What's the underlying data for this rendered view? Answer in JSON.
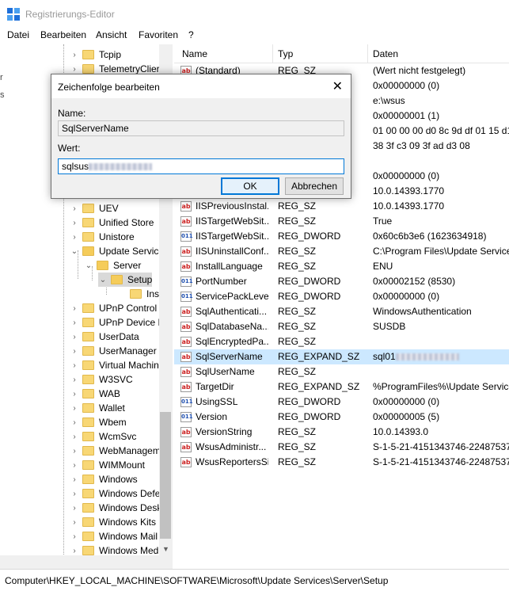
{
  "window": {
    "title": "Registrierungs-Editor"
  },
  "menu": [
    "Datei",
    "Bearbeiten",
    "Ansicht",
    "Favoriten",
    "?"
  ],
  "left_edge_chars": [
    "r",
    "s"
  ],
  "tree": {
    "items": [
      {
        "label": "Tcpip",
        "expander": "›",
        "open": false
      },
      {
        "label": "TelemetryClier",
        "expander": "›",
        "open": false
      },
      {
        "label": "UEV",
        "expander": "›",
        "open": false
      },
      {
        "label": "Unified Store",
        "expander": "›",
        "open": false
      },
      {
        "label": "Unistore",
        "expander": "›",
        "open": false
      },
      {
        "label": "Update Service",
        "expander": "⌄",
        "open": true
      },
      {
        "label": "Server",
        "expander": "⌄",
        "open": true
      },
      {
        "label": "Setup",
        "expander": "⌄",
        "open": true
      },
      {
        "label": "Inst",
        "expander": "",
        "open": false
      },
      {
        "label": "UPnP Control",
        "expander": "›",
        "open": false
      },
      {
        "label": "UPnP Device H",
        "expander": "›",
        "open": false
      },
      {
        "label": "UserData",
        "expander": "›",
        "open": false
      },
      {
        "label": "UserManager",
        "expander": "›",
        "open": false
      },
      {
        "label": "Virtual Machin",
        "expander": "›",
        "open": false
      },
      {
        "label": "W3SVC",
        "expander": "›",
        "open": false
      },
      {
        "label": "WAB",
        "expander": "›",
        "open": false
      },
      {
        "label": "Wallet",
        "expander": "›",
        "open": false
      },
      {
        "label": "Wbem",
        "expander": "›",
        "open": false
      },
      {
        "label": "WcmSvc",
        "expander": "›",
        "open": false
      },
      {
        "label": "WebManagem",
        "expander": "›",
        "open": false
      },
      {
        "label": "WIMMount",
        "expander": "›",
        "open": false
      },
      {
        "label": "Windows",
        "expander": "›",
        "open": false
      },
      {
        "label": "Windows Defe",
        "expander": "›",
        "open": false
      },
      {
        "label": "Windows Desk",
        "expander": "›",
        "open": false
      },
      {
        "label": "Windows Kits",
        "expander": "›",
        "open": false
      },
      {
        "label": "Windows Mail",
        "expander": "›",
        "open": false
      },
      {
        "label": "Windows Med",
        "expander": "›",
        "open": false
      }
    ]
  },
  "columns": {
    "name": "Name",
    "type": "Typ",
    "data": "Daten"
  },
  "values": [
    {
      "name": "(Standard)",
      "type": "REG_SZ",
      "data": "(Wert nicht festgelegt)",
      "icon": "ab",
      "selected": false,
      "redacted": false
    },
    {
      "name": "",
      "type": "",
      "data": "0x00000000 (0)",
      "icon": "",
      "selected": false,
      "redacted": false
    },
    {
      "name": "",
      "type": "",
      "data": "e:\\wsus",
      "icon": "",
      "selected": false,
      "redacted": false
    },
    {
      "name": "",
      "type": "",
      "data": "0x00000001 (1)",
      "icon": "",
      "selected": false,
      "redacted": false
    },
    {
      "name": "",
      "type": "",
      "data": "01 00 00 00 d0 8c 9d df 01 15 d1 1",
      "icon": "",
      "selected": false,
      "redacted": false
    },
    {
      "name": "",
      "type": "",
      "data": "38 3f c3 09 3f ad d3 08",
      "icon": "",
      "selected": false,
      "redacted": false
    },
    {
      "name": "",
      "type": "",
      "data": "",
      "icon": "",
      "selected": false,
      "redacted": false
    },
    {
      "name": "",
      "type": "",
      "data": "0x00000000 (0)",
      "icon": "",
      "selected": false,
      "redacted": false
    },
    {
      "name": "",
      "type": "",
      "data": "10.0.14393.1770",
      "icon": "",
      "selected": false,
      "redacted": false
    },
    {
      "name": "IISPreviousInstal...",
      "type": "REG_SZ",
      "data": "10.0.14393.1770",
      "icon": "ab",
      "selected": false,
      "redacted": false
    },
    {
      "name": "IISTargetWebSit...",
      "type": "REG_SZ",
      "data": "True",
      "icon": "ab",
      "selected": false,
      "redacted": false
    },
    {
      "name": "IISTargetWebSit...",
      "type": "REG_DWORD",
      "data": "0x60c6b3e6 (1623634918)",
      "icon": "bin",
      "selected": false,
      "redacted": false
    },
    {
      "name": "IISUninstallConf...",
      "type": "REG_SZ",
      "data": "C:\\Program Files\\Update Services",
      "icon": "ab",
      "selected": false,
      "redacted": false
    },
    {
      "name": "InstallLanguage",
      "type": "REG_SZ",
      "data": "ENU",
      "icon": "ab",
      "selected": false,
      "redacted": false
    },
    {
      "name": "PortNumber",
      "type": "REG_DWORD",
      "data": "0x00002152 (8530)",
      "icon": "bin",
      "selected": false,
      "redacted": false
    },
    {
      "name": "ServicePackLevel",
      "type": "REG_DWORD",
      "data": "0x00000000 (0)",
      "icon": "bin",
      "selected": false,
      "redacted": false
    },
    {
      "name": "SqlAuthenticati...",
      "type": "REG_SZ",
      "data": "WindowsAuthentication",
      "icon": "ab",
      "selected": false,
      "redacted": false
    },
    {
      "name": "SqlDatabaseNa...",
      "type": "REG_SZ",
      "data": "SUSDB",
      "icon": "ab",
      "selected": false,
      "redacted": false
    },
    {
      "name": "SqlEncryptedPa...",
      "type": "REG_SZ",
      "data": "",
      "icon": "ab",
      "selected": false,
      "redacted": false
    },
    {
      "name": "SqlServerName",
      "type": "REG_EXPAND_SZ",
      "data": "sql01",
      "icon": "ab",
      "selected": true,
      "redacted": true
    },
    {
      "name": "SqlUserName",
      "type": "REG_SZ",
      "data": "",
      "icon": "ab",
      "selected": false,
      "redacted": false
    },
    {
      "name": "TargetDir",
      "type": "REG_EXPAND_SZ",
      "data": "%ProgramFiles%\\Update Services\\",
      "icon": "ab",
      "selected": false,
      "redacted": false
    },
    {
      "name": "UsingSSL",
      "type": "REG_DWORD",
      "data": "0x00000000 (0)",
      "icon": "bin",
      "selected": false,
      "redacted": false
    },
    {
      "name": "Version",
      "type": "REG_DWORD",
      "data": "0x00000005 (5)",
      "icon": "bin",
      "selected": false,
      "redacted": false
    },
    {
      "name": "VersionString",
      "type": "REG_SZ",
      "data": "10.0.14393.0",
      "icon": "ab",
      "selected": false,
      "redacted": false
    },
    {
      "name": "WsusAdministr...",
      "type": "REG_SZ",
      "data": "S-1-5-21-4151343746-2248753737",
      "icon": "ab",
      "selected": false,
      "redacted": false
    },
    {
      "name": "WsusReportersSid",
      "type": "REG_SZ",
      "data": "S-1-5-21-4151343746-2248753737",
      "icon": "ab",
      "selected": false,
      "redacted": false
    }
  ],
  "status": "Computer\\HKEY_LOCAL_MACHINE\\SOFTWARE\\Microsoft\\Update Services\\Server\\Setup",
  "dialog": {
    "title": "Zeichenfolge bearbeiten",
    "close": "✕",
    "name_label": "Name:",
    "name_value": "SqlServerName",
    "value_label": "Wert:",
    "value_text": "sqlsus",
    "ok": "OK",
    "cancel": "Abbrechen"
  },
  "colors": {
    "selection": "#cce8ff",
    "accent": "#0078d7",
    "folder": "#f8d775"
  }
}
